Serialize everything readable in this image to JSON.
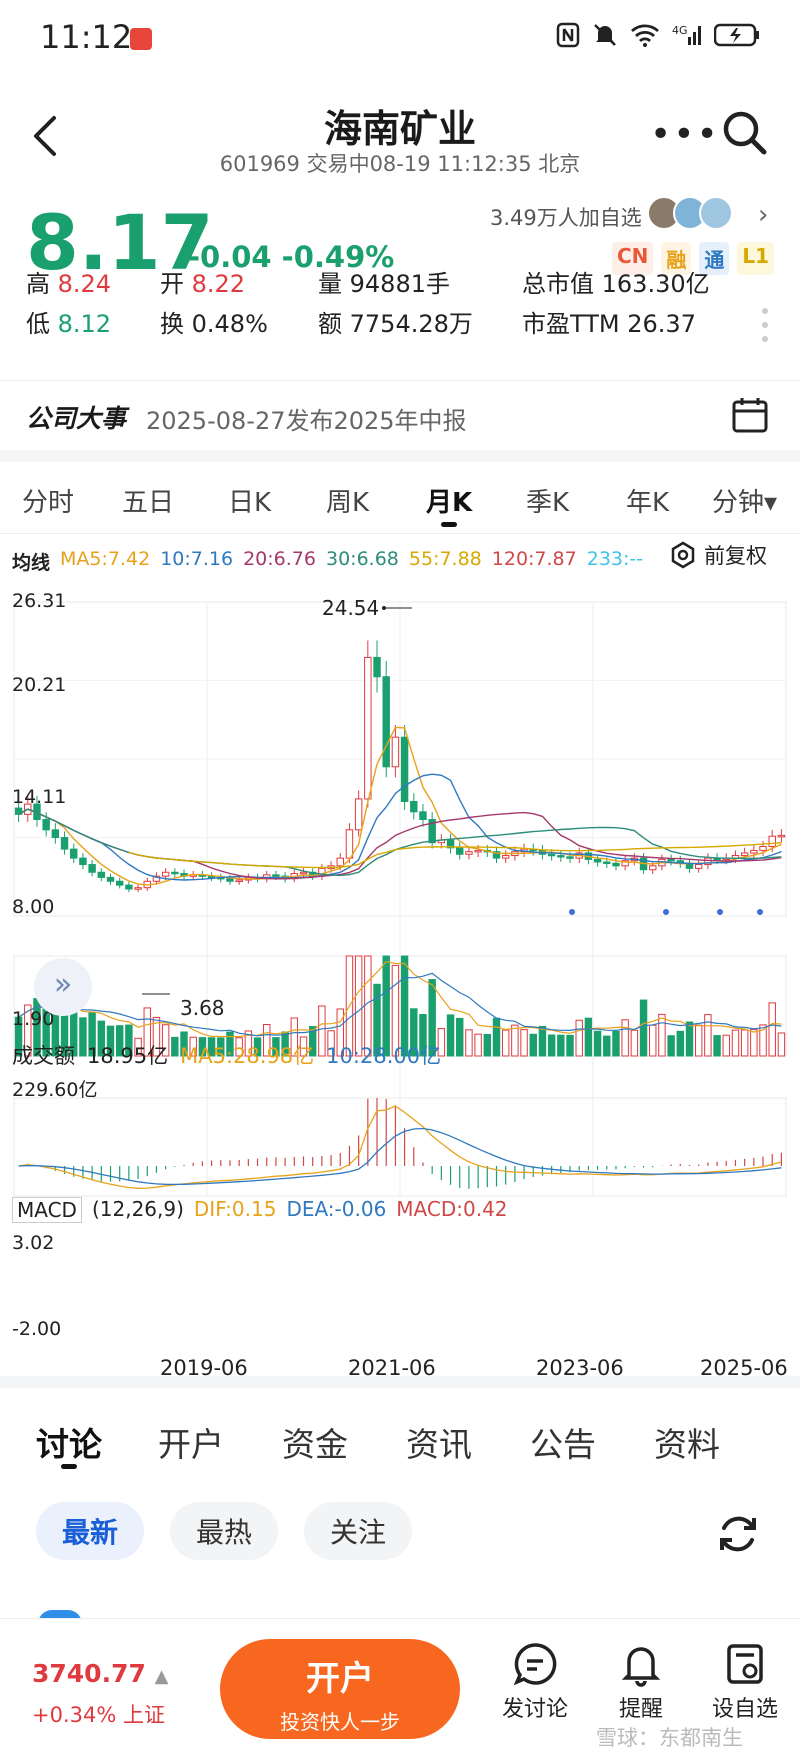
{
  "status_bar": {
    "time": "11:12"
  },
  "header": {
    "title": "海南矿业",
    "subtitle": "601969 交易中08-19 11:12:35 北京"
  },
  "quote": {
    "price": "8.17",
    "change": "-0.04 -0.49%",
    "followers": "3.49万人加自选",
    "tags": [
      "CN",
      "融",
      "通",
      "L1"
    ],
    "stats": [
      {
        "label": "高",
        "value": "8.24",
        "tone": "red"
      },
      {
        "label": "开",
        "value": "8.22",
        "tone": "red"
      },
      {
        "label": "量",
        "value": "94881手",
        "tone": "plain"
      },
      {
        "label": "总市值",
        "value": "163.30亿",
        "tone": "plain"
      },
      {
        "label": "低",
        "value": "8.12",
        "tone": "green"
      },
      {
        "label": "换",
        "value": "0.48%",
        "tone": "plain"
      },
      {
        "label": "额",
        "value": "7754.28万",
        "tone": "plain"
      },
      {
        "label": "市盈TTM",
        "value": "26.37",
        "tone": "plain"
      }
    ]
  },
  "event": {
    "label": "公司大事",
    "text": "2025-08-27发布2025年中报"
  },
  "chart_tabs": [
    "分时",
    "五日",
    "日K",
    "周K",
    "月K",
    "季K",
    "年K",
    "分钟▾"
  ],
  "active_chart_tab": "月K",
  "ma_legend": {
    "label": "均线",
    "items": [
      {
        "text": "MA5:7.42",
        "color": "#e8a21a"
      },
      {
        "text": "10:7.16",
        "color": "#2f79c0"
      },
      {
        "text": "20:6.76",
        "color": "#a4386b"
      },
      {
        "text": "30:6.68",
        "color": "#2e8c7a"
      },
      {
        "text": "55:7.88",
        "color": "#d6a800"
      },
      {
        "text": "120:7.87",
        "color": "#d04848"
      },
      {
        "text": "233:--",
        "color": "#3ec3e6"
      }
    ],
    "adjust": "前复权"
  },
  "price_axis": [
    "26.31",
    "20.21",
    "14.11",
    "8.00",
    "1.90"
  ],
  "price_marks": {
    "high": "24.54",
    "low": "3.68"
  },
  "volume": {
    "label": "成交额",
    "value": "18.95亿",
    "ma5": "MA5:28.98亿",
    "ma10": "10:28.00亿",
    "axis_top": "229.60亿"
  },
  "macd": {
    "label": "MACD",
    "params": "(12,26,9)",
    "dif": "DIF:0.15",
    "dea": "DEA:-0.06",
    "macd": "MACD:0.42",
    "axis_top": "3.02",
    "axis_bottom": "-2.00"
  },
  "x_axis": [
    "2019-06",
    "2021-06",
    "2023-06",
    "2025-06"
  ],
  "chart_data": {
    "type": "candlestick",
    "interval": "monthly",
    "ylim": [
      1.9,
      26.31
    ],
    "x_ticks": [
      "2019-06",
      "2021-06",
      "2023-06",
      "2025-06"
    ],
    "annotated_high": 24.54,
    "annotated_low": 3.68,
    "approx_close_series": [
      9.8,
      10.6,
      9.4,
      8.6,
      8.0,
      7.1,
      6.4,
      5.9,
      5.3,
      4.9,
      4.6,
      4.3,
      4.0,
      4.1,
      4.6,
      5.0,
      5.3,
      5.2,
      5.0,
      5.1,
      5.0,
      4.9,
      4.8,
      4.6,
      4.7,
      4.9,
      4.8,
      5.1,
      5.0,
      4.8,
      5.2,
      5.3,
      5.0,
      5.6,
      5.8,
      6.4,
      8.6,
      11.0,
      22.0,
      20.5,
      13.5,
      15.8,
      10.8,
      10.0,
      9.4,
      7.6,
      7.8,
      7.2,
      6.7,
      6.9,
      7.0,
      6.9,
      6.4,
      6.6,
      6.9,
      7.1,
      7.0,
      6.7,
      6.6,
      6.5,
      6.4,
      6.8,
      6.3,
      6.1,
      6.0,
      5.8,
      6.2,
      6.4,
      5.5,
      5.8,
      6.3,
      6.2,
      6.0,
      5.6,
      5.9,
      6.4,
      6.3,
      6.4,
      6.6,
      6.8,
      7.0,
      7.3,
      8.1,
      8.17
    ],
    "volume_axis_top": "229.60亿",
    "macd_range": [
      -2.0,
      3.02
    ]
  },
  "bottom_tabs": [
    "讨论",
    "开户",
    "资金",
    "资讯",
    "公告",
    "资料"
  ],
  "filter_pills": [
    "最新",
    "最热",
    "关注"
  ],
  "bottom_bar": {
    "index_value": "3740.77",
    "index_change": "+0.34% 上证",
    "open_account": "开户",
    "open_account_sub": "投资快人一步",
    "actions": [
      "发讨论",
      "提醒",
      "设自选"
    ]
  },
  "watermark": "雪球：东都南生"
}
